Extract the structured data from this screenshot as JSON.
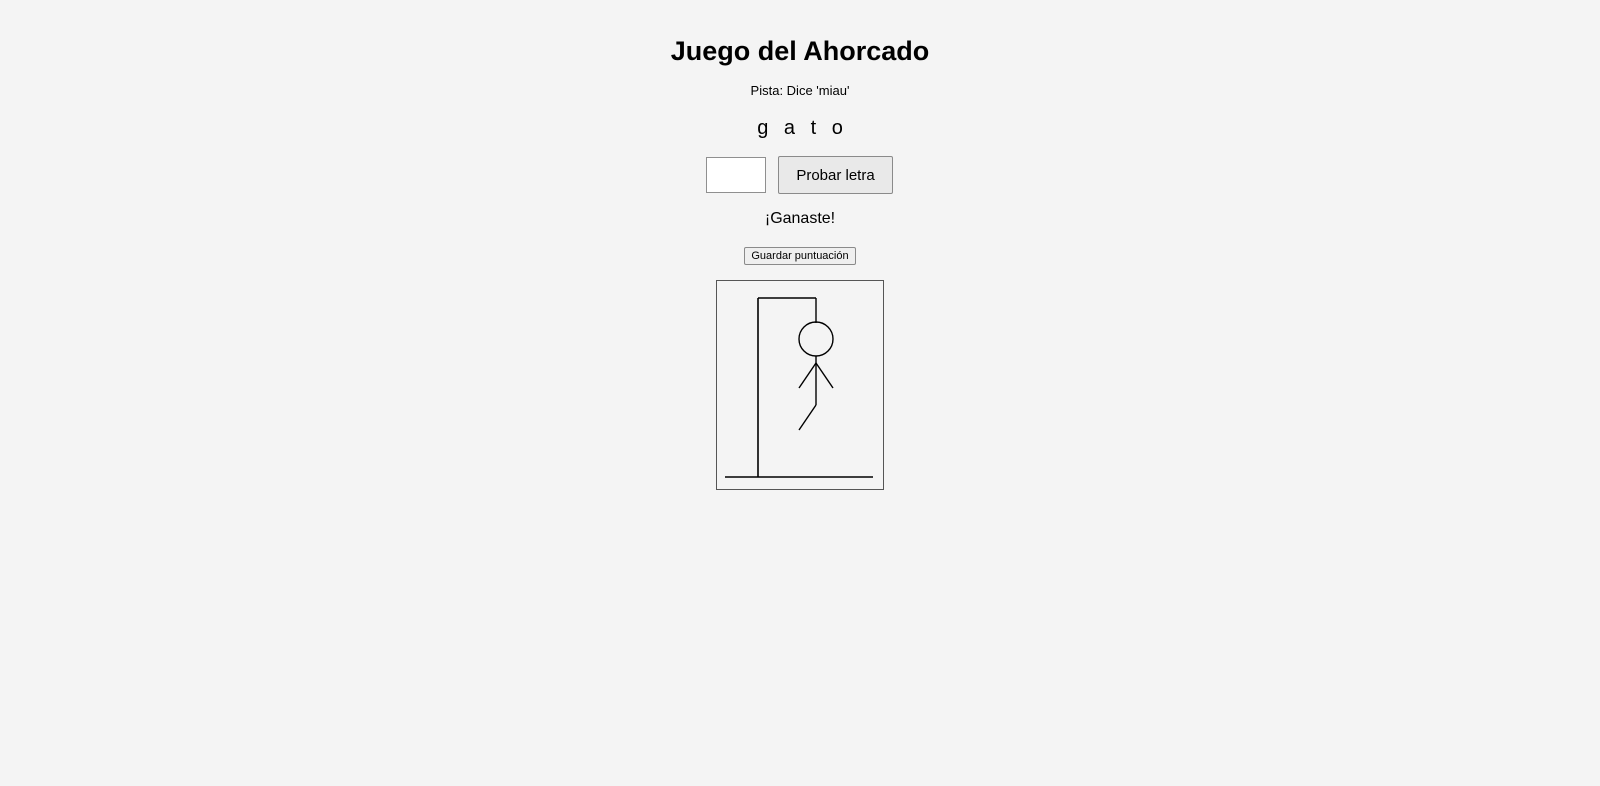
{
  "game": {
    "title": "Juego del Ahorcado",
    "hint": "Pista: Dice 'miau'",
    "revealed_letters": [
      "g",
      "a",
      "t",
      "o"
    ],
    "letter_input": {
      "value": "",
      "placeholder": ""
    },
    "try_button_label": "Probar letra",
    "result_message": "¡Ganaste!",
    "save_button_label": "Guardar puntuación"
  },
  "drawing": {
    "parts_drawn": [
      "base",
      "pole",
      "beam",
      "rope",
      "head",
      "body",
      "left-arm",
      "right-arm",
      "left-leg"
    ],
    "stroke_color": "#000000"
  }
}
